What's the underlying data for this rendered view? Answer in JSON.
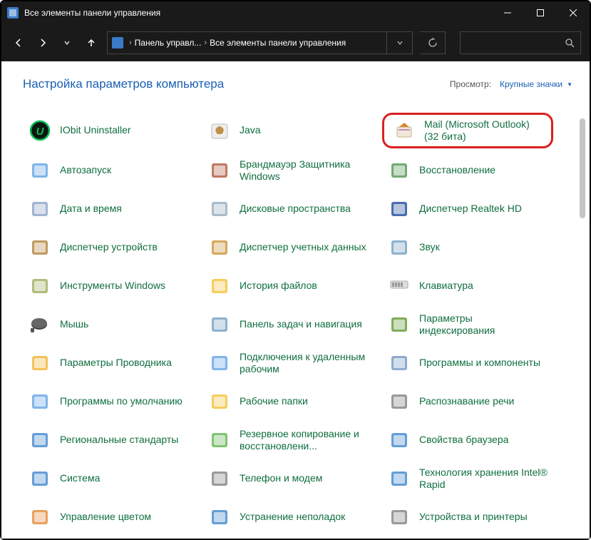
{
  "titlebar": {
    "title": "Все элементы панели управления"
  },
  "breadcrumb": {
    "part1": "Панель управл...",
    "part2": "Все элементы панели управления"
  },
  "content": {
    "heading": "Настройка параметров компьютера",
    "view_label": "Просмотр:",
    "view_value": "Крупные значки"
  },
  "items": [
    {
      "label": "IObit Uninstaller"
    },
    {
      "label": "Java"
    },
    {
      "label": "Mail (Microsoft Outlook) (32 бита)",
      "highlighted": true
    },
    {
      "label": "Автозапуск"
    },
    {
      "label": "Брандмауэр Защитника Windows"
    },
    {
      "label": "Восстановление"
    },
    {
      "label": "Дата и время"
    },
    {
      "label": "Дисковые пространства"
    },
    {
      "label": "Диспетчер Realtek HD"
    },
    {
      "label": "Диспетчер устройств"
    },
    {
      "label": "Диспетчер учетных данных"
    },
    {
      "label": "Звук"
    },
    {
      "label": "Инструменты Windows"
    },
    {
      "label": "История файлов"
    },
    {
      "label": "Клавиатура"
    },
    {
      "label": "Мышь"
    },
    {
      "label": "Панель задач и навигация"
    },
    {
      "label": "Параметры индексирования"
    },
    {
      "label": "Параметры Проводника"
    },
    {
      "label": "Подключения к удаленным рабочим"
    },
    {
      "label": "Программы и компоненты"
    },
    {
      "label": "Программы по умолчанию"
    },
    {
      "label": "Рабочие папки"
    },
    {
      "label": "Распознавание речи"
    },
    {
      "label": "Региональные стандарты"
    },
    {
      "label": "Резервное копирование и восстановлени..."
    },
    {
      "label": "Свойства браузера"
    },
    {
      "label": "Система"
    },
    {
      "label": "Телефон и модем"
    },
    {
      "label": "Технология хранения Intel® Rapid"
    },
    {
      "label": "Управление цветом"
    },
    {
      "label": "Устранение неполадок"
    },
    {
      "label": "Устройства и принтеры"
    }
  ],
  "icon_colors": {
    "0": "#10b956",
    "1": "#c09048",
    "2": "#d9842e",
    "3": "#6aa8e6",
    "4": "#b5624a",
    "5": "#5b9c5b",
    "6": "#8fa8c8",
    "7": "#9ab0c0",
    "8": "#2a54a0",
    "9": "#b58a48",
    "10": "#cc9a3f",
    "11": "#7aa5c4",
    "12": "#a5b064",
    "13": "#f5c542",
    "14": "#888",
    "15": "#555",
    "16": "#7aa5c4",
    "17": "#6a9d3e",
    "18": "#f2b740",
    "19": "#6aa8e6",
    "20": "#7a9dc8",
    "21": "#6aa8e6",
    "22": "#f5c542",
    "23": "#888",
    "24": "#4a8dce",
    "25": "#6aba5a",
    "26": "#4a8dce",
    "27": "#4a8dce",
    "28": "#888",
    "29": "#4a8dce",
    "30": "#e59040",
    "31": "#4a8dce",
    "32": "#888"
  }
}
